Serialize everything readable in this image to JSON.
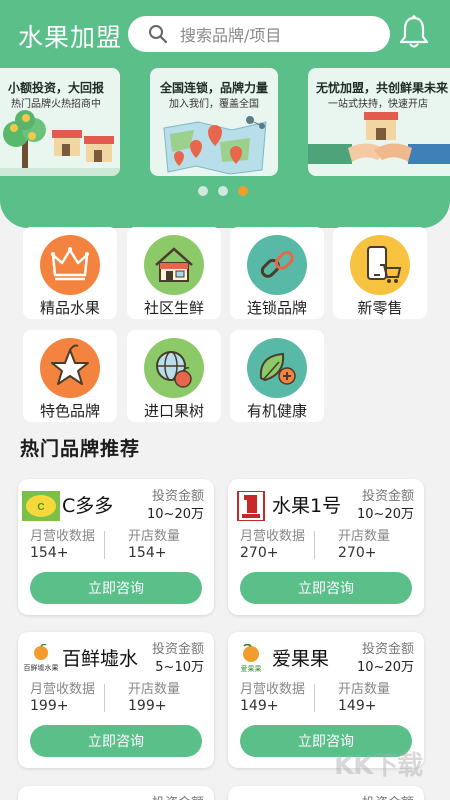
{
  "header": {
    "title": "水果加盟",
    "search_placeholder": "搜索品牌/项目"
  },
  "banners": [
    {
      "title": "小额投资，大回报",
      "subtitle": "热门品牌火热招商中"
    },
    {
      "title": "全国连锁，品牌力量",
      "subtitle": "加入我们，覆盖全国"
    },
    {
      "title": "无忧加盟，共创鲜果未来",
      "subtitle": "一站式扶持，快速开店"
    }
  ],
  "carousel": {
    "page_count": 3,
    "active_index": 2
  },
  "categories": [
    {
      "label": "精品水果",
      "icon": "crown-icon",
      "color": "#f3833f"
    },
    {
      "label": "社区生鲜",
      "icon": "store-icon",
      "color": "#8cc969"
    },
    {
      "label": "连锁品牌",
      "icon": "chain-link-icon",
      "color": "#58b9a6"
    },
    {
      "label": "新零售",
      "icon": "phone-cart-icon",
      "color": "#f7c23f"
    },
    {
      "label": "特色品牌",
      "icon": "star-fruit-icon",
      "color": "#f3833f"
    },
    {
      "label": "进口果树",
      "icon": "globe-apple-icon",
      "color": "#8cc969"
    },
    {
      "label": "有机健康",
      "icon": "leaf-plus-icon",
      "color": "#58b9a6"
    }
  ],
  "section": {
    "hot_brands_title": "热门品牌推荐"
  },
  "brand_cards": [
    {
      "name": "C多多",
      "invest_label": "投资金额",
      "invest_value": "10~20万",
      "revenue_label": "月营收数据",
      "revenue_value": "154+",
      "stores_label": "开店数量",
      "stores_value": "154+",
      "cta": "立即咨询"
    },
    {
      "name": "水果1号",
      "invest_label": "投资金额",
      "invest_value": "10~20万",
      "revenue_label": "月营收数据",
      "revenue_value": "270+",
      "stores_label": "开店数量",
      "stores_value": "270+",
      "cta": "立即咨询"
    },
    {
      "name": "百鲜墟水",
      "logo_text": "百鲜墟水果",
      "invest_label": "投资金额",
      "invest_value": "5~10万",
      "revenue_label": "月营收数据",
      "revenue_value": "199+",
      "stores_label": "开店数量",
      "stores_value": "199+",
      "cta": "立即咨询"
    },
    {
      "name": "爱果果",
      "logo_text": "爱果果",
      "invest_label": "投资金额",
      "invest_value": "10~20万",
      "revenue_label": "月营收数据",
      "revenue_value": "149+",
      "stores_label": "开店数量",
      "stores_value": "149+",
      "cta": "立即咨询"
    }
  ],
  "partial_cards": [
    {
      "invest_label": "投资金额"
    },
    {
      "invest_label": "投资金额"
    }
  ],
  "watermark": "KK下载",
  "colors": {
    "primary": "#5bbf8a",
    "accent_dot": "#f39c2e",
    "background": "#f2f2f2"
  }
}
